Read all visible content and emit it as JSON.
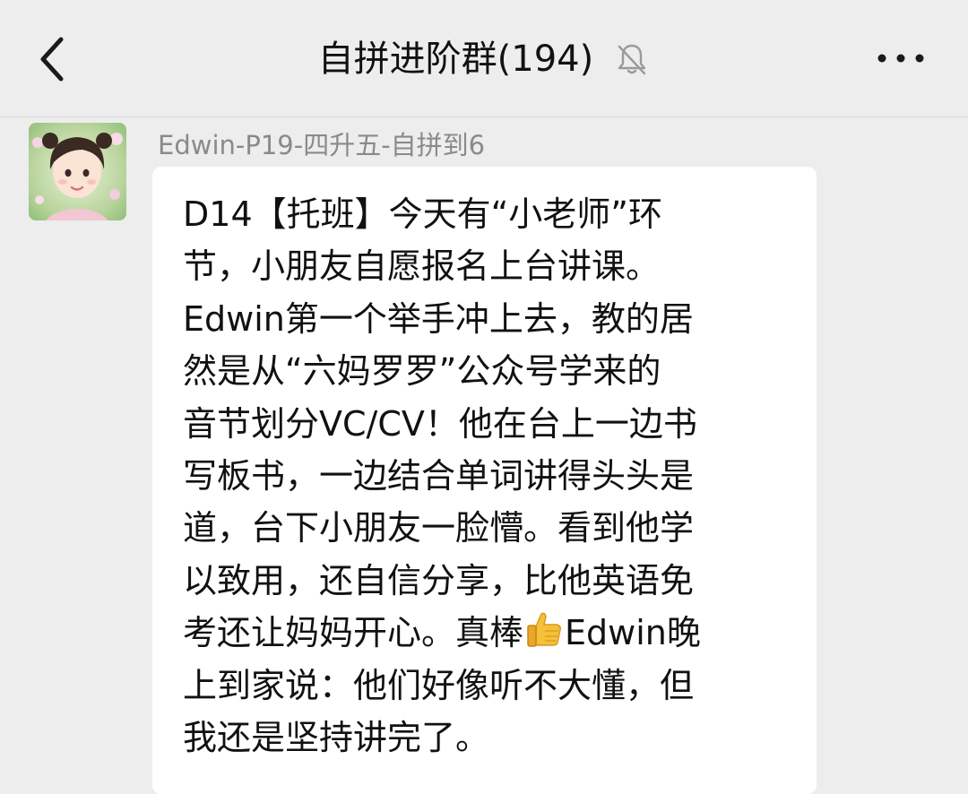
{
  "header": {
    "title": "自拼进阶群(194)",
    "back_icon": "chevron-left-icon",
    "mute_icon": "bell-off-icon",
    "more_icon": "more-dots-icon"
  },
  "message": {
    "sender": "Edwin-P19-四升五-自拼到6",
    "avatar_icon": "user-avatar",
    "lines": [
      "D14【托班】今天有“小老师”环",
      "节，小朋友自愿报名上台讲课。",
      "Edwin第一个举手冲上去，教的居",
      "然是从“六妈罗罗”公众号学来的",
      "音节划分VC/CV！他在台上一边书",
      "写板书，一边结合单词讲得头头是",
      "道，台下小朋友一脸懵。看到他学",
      "以致用，还自信分享，比他英语免",
      {
        "before": "考还让妈妈开心。真棒",
        "emoji": "thumbs-up-icon",
        "after": "Edwin晚"
      },
      "上到家说：他们好像听不大懂，但",
      "我还是坚持讲完了。"
    ]
  },
  "colors": {
    "background": "#ededed",
    "bubble": "#ffffff",
    "text": "#111111",
    "sender": "#8a8a8a",
    "icon": "#1a1a1a"
  }
}
